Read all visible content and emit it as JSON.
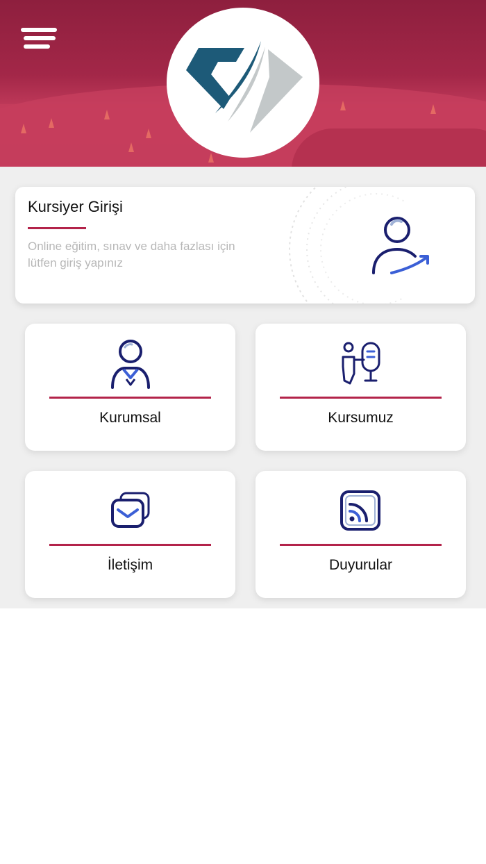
{
  "header": {
    "menu_icon": "hamburger-menu-icon",
    "logo": "diamond-logo",
    "colors": {
      "overlay": "#a32748",
      "logo_blue": "#1d5a78",
      "logo_gray": "#c3c8c9"
    }
  },
  "login_card": {
    "title": "Kursiyer Girişi",
    "description": "Online eğitim, sınav ve daha fazlası için lütfen giriş yapınız",
    "icon": "user-login-icon"
  },
  "tiles": [
    {
      "label": "Kurumsal",
      "icon": "corporate-person-icon"
    },
    {
      "label": "Kursumuz",
      "icon": "instructor-board-icon"
    },
    {
      "label": "İletişim",
      "icon": "envelope-icon"
    },
    {
      "label": "Duyurular",
      "icon": "rss-feed-icon"
    }
  ],
  "colors": {
    "accent": "#b3234a",
    "icon": "#1a1f6e",
    "background": "#efefef"
  }
}
